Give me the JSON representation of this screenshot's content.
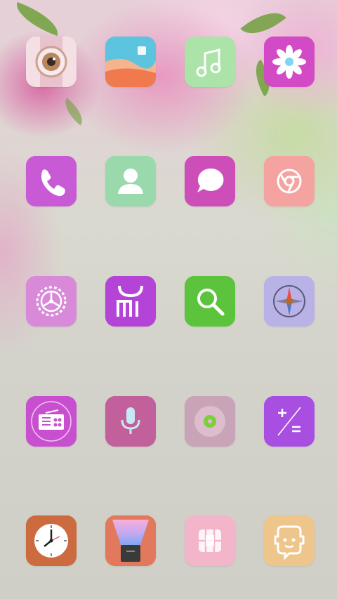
{
  "home_screen": {
    "apps": [
      {
        "icon": "camera-icon",
        "color": "#f2d4dc"
      },
      {
        "icon": "gallery-icon",
        "color": "#f08a5e"
      },
      {
        "icon": "music-icon",
        "color": "#a8e4a8"
      },
      {
        "icon": "themes-icon",
        "color": "#d44cc8"
      },
      {
        "icon": "phone-icon",
        "color": "#c75ad6"
      },
      {
        "icon": "contacts-icon",
        "color": "#9fdcb0"
      },
      {
        "icon": "messaging-icon",
        "color": "#cf4fb9"
      },
      {
        "icon": "browser-icon",
        "color": "#f3a2a2"
      },
      {
        "icon": "settings-icon",
        "color": "#d68ad9"
      },
      {
        "icon": "mi-store-icon",
        "color": "#b23fd9"
      },
      {
        "icon": "search-icon",
        "color": "#5bc43b"
      },
      {
        "icon": "compass-icon",
        "color": "#b9b2e6"
      },
      {
        "icon": "radio-icon",
        "color": "#c84ed0"
      },
      {
        "icon": "voice-recorder-icon",
        "color": "#c15f9c"
      },
      {
        "icon": "music-disc-icon",
        "color": "#caa2b8"
      },
      {
        "icon": "calculator-icon",
        "color": "#a84fe3"
      },
      {
        "icon": "clock-icon",
        "color": "#cf6a40"
      },
      {
        "icon": "flashlight-icon",
        "color": "#e07a5f"
      },
      {
        "icon": "sim-toolkit-icon",
        "color": "#f2b3c8"
      },
      {
        "icon": "feedback-icon",
        "color": "#edc48a"
      }
    ]
  }
}
